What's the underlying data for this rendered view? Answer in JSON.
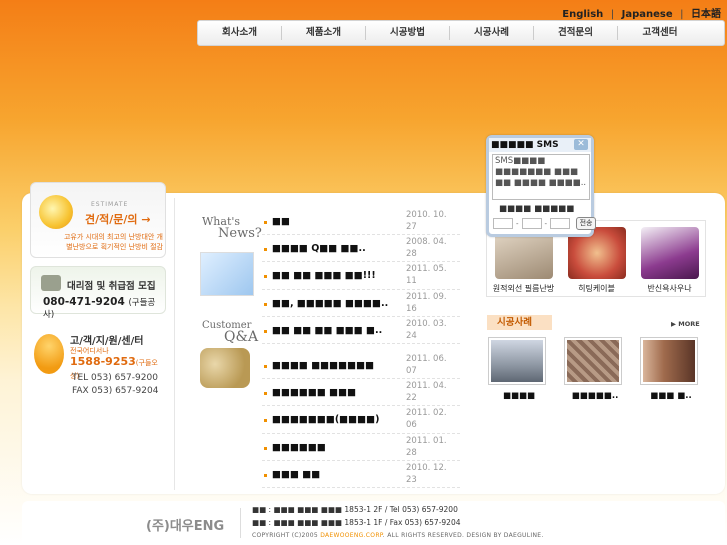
{
  "lang": {
    "english": "English",
    "japanese": "Japanese",
    "other": "日本語",
    "sep": "|"
  },
  "nav": {
    "items": [
      "회사소개",
      "제품소개",
      "시공방법",
      "시공사례",
      "견적문의",
      "고객센터"
    ]
  },
  "estimate": {
    "small": "ESTIMATE",
    "title": "견/적/문/의  →",
    "desc": "고유가 시대의 최고의 난방대안 개별난방으로 획기적인 난방비 절감"
  },
  "agent": {
    "title": "대리점 및 취급점 모집",
    "phone": "080-471-9204",
    "phone_note": "(구들공사)"
  },
  "cs": {
    "title": "고/객/지/원/센/터",
    "sub": "전국어디서나",
    "num": "1588-9253",
    "num_note": "(구들오성)",
    "tel": "TEL  053) 657-9200",
    "fax": "FAX  053) 657-9204"
  },
  "news": {
    "label_small": "What's",
    "label_big": "News?",
    "items": [
      {
        "title": "■■",
        "date": "2010. 10. 27"
      },
      {
        "title": "■■■■ Q■■ ■■..",
        "date": "2008. 04. 28"
      },
      {
        "title": "■■ ■■ ■■■ ■■!!!",
        "date": "2011. 05. 11"
      },
      {
        "title": "■■, ■■■■■ ■■■■..",
        "date": "2011. 09. 16"
      },
      {
        "title": "■■ ■■ ■■ ■■■ ■..",
        "date": "2010. 03. 24"
      }
    ]
  },
  "qa": {
    "label_small": "Customer",
    "label_big": "Q&A",
    "items": [
      {
        "title": "■■■■ ■■■■■■■",
        "date": "2011. 06. 07"
      },
      {
        "title": "■■■■■■ ■■■",
        "date": "2011. 04. 22"
      },
      {
        "title": "■■■■■■■(■■■■)",
        "date": "2011. 02. 06"
      },
      {
        "title": "■■■■■■",
        "date": "2011. 01. 28"
      },
      {
        "title": "■■■ ■■",
        "date": "2010. 12. 23"
      }
    ]
  },
  "products": [
    {
      "label": "원적외선 필름난방",
      "color": "#b8a08a"
    },
    {
      "label": "히팅케이블",
      "color": "#c94c3c"
    },
    {
      "label": "반신욕사우나",
      "color": "#6b2a6e"
    }
  ],
  "cases": {
    "title": "시공사례",
    "more": "▶ MORE",
    "items": [
      {
        "label": "■■■■",
        "color": "#8e97a3"
      },
      {
        "label": "■■■■■..",
        "color": "#9a7b68"
      },
      {
        "label": "■■■ ■..",
        "color": "#a06b4d"
      }
    ]
  },
  "sms": {
    "title": "■■■■■ SMS",
    "close": "✕",
    "text": "SMS■■■■ ■■■■■■■ ■■■ ■■ ■■■■ ■■■■..",
    "label": "■■■■ ■■■■■",
    "send": "전송"
  },
  "footer": {
    "logo": "(주)대우ENG",
    "line1": "■■ : ■■■ ■■■ ■■■ 1853-1 2F  /  Tel 053) 657-9200",
    "line2": "■■ : ■■■ ■■■ ■■■ 1853-1 1F  /  Fax 053) 657-9204",
    "copy_a": "COPYRIGHT (C)2005 ",
    "copy_b": "DAEWOOENG.CORP",
    "copy_c": ". ALL RIGHTS RESERVED. DESIGN BY DAEGULINE."
  }
}
